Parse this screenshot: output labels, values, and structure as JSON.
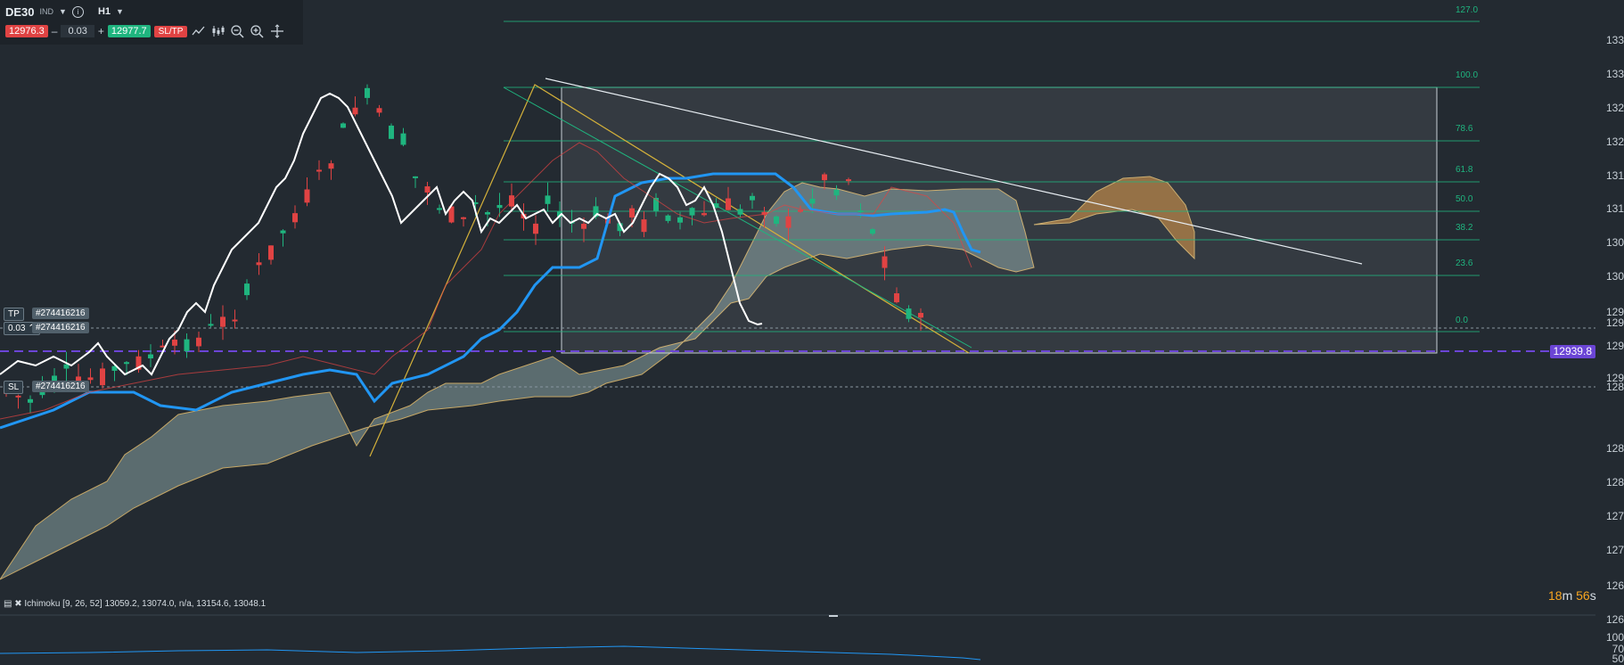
{
  "toolbar": {
    "symbol": "DE30",
    "symbol_type": "IND",
    "timeframe": "H1",
    "sell_price": "12976.3",
    "volume": "0.03",
    "buy_price": "12977.7",
    "sltp_label": "SL/TP",
    "minus": "–",
    "plus": "+",
    "info": "i"
  },
  "order_tags": {
    "tp_label": "TP",
    "tp_id": "#274416216",
    "pos_volume": "0.03",
    "pos_id": "#274416216",
    "sl_label": "SL",
    "sl_id": "#274416216"
  },
  "price_marker": "12939.8",
  "y_axis_ticks": [
    "133",
    "133",
    "132",
    "132",
    "131",
    "131",
    "130",
    "130",
    "129",
    "129",
    "129",
    "129",
    "128",
    "128",
    "128",
    "127",
    "127",
    "126",
    "126"
  ],
  "fib_levels": [
    {
      "label": "127.0"
    },
    {
      "label": "100.0"
    },
    {
      "label": "78.6"
    },
    {
      "label": "61.8"
    },
    {
      "label": "50.0"
    },
    {
      "label": "38.2"
    },
    {
      "label": "23.6"
    },
    {
      "label": "0.0"
    }
  ],
  "indicator": "Ichimoku [9, 26, 52] 13059.2, 13074.0, n/a, 13154.6, 13048.1",
  "timer": {
    "minutes": "18",
    "m": "m",
    "seconds": "56",
    "s": "s"
  },
  "sub_axis": [
    "100",
    "70",
    "50"
  ],
  "colors": {
    "background": "#232a31",
    "bull": "#1fb57f",
    "bear": "#e04343",
    "kijun": "#2196f3",
    "chikou": "#ffffff",
    "cloud": "#8aa3a3",
    "cloud_bear": "#b07a3a",
    "fib": "#1fb57f",
    "trend": "#d4b13a",
    "marker": "#6b45d6"
  }
}
